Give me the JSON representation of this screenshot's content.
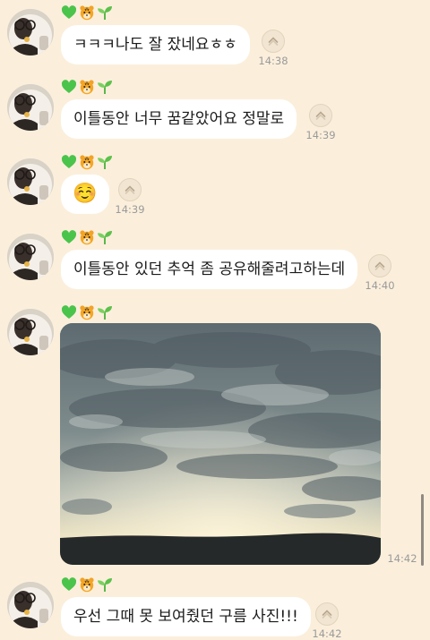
{
  "chat": {
    "messages": [
      {
        "sender_badges": [
          "green-heart",
          "tiger",
          "seedling"
        ],
        "text": "ㅋㅋㅋ나도 잘 잤네요ㅎㅎ",
        "time": "14:38"
      },
      {
        "sender_badges": [
          "green-heart",
          "tiger",
          "seedling"
        ],
        "text": "이틀동안 너무 꿈같았어요 정말로",
        "time": "14:39"
      },
      {
        "sender_badges": [
          "green-heart",
          "tiger",
          "seedling"
        ],
        "text": "☺️",
        "time": "14:39"
      },
      {
        "sender_badges": [
          "green-heart",
          "tiger",
          "seedling"
        ],
        "text": "이틀동안 있던 추억 좀 공유해줄려고하는데",
        "time": "14:40"
      },
      {
        "sender_badges": [
          "green-heart",
          "tiger",
          "seedling"
        ],
        "type": "photo",
        "time": "14:42"
      },
      {
        "sender_badges": [
          "green-heart",
          "tiger",
          "seedling"
        ],
        "text": "우선 그때 못 보여줬던 구름 사진!!!",
        "time": "14:42"
      }
    ]
  },
  "colors": {
    "background": "#fbefdc",
    "bubble": "#ffffff",
    "time_text": "#9a9a9a"
  }
}
